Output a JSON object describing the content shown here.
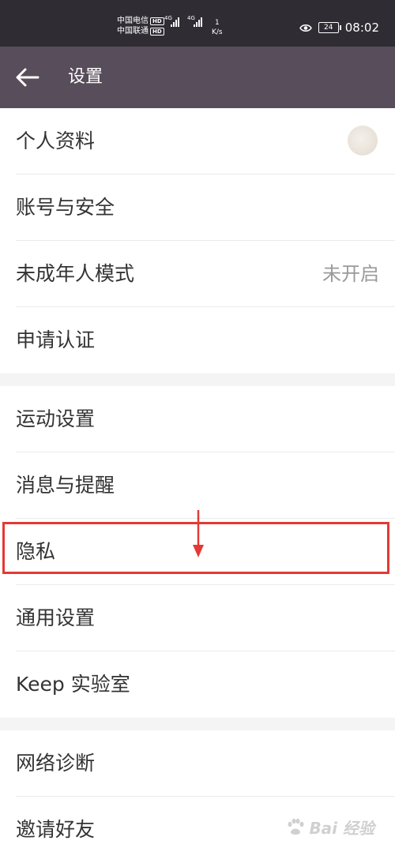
{
  "status_bar": {
    "carrier1": "中国电信",
    "carrier2": "中国联通",
    "hd": "HD",
    "net_tag": "4G",
    "speed_value": "1",
    "speed_unit": "K/s",
    "battery": "24",
    "time": "08:02"
  },
  "header": {
    "title": "设置",
    "back_icon": "back-arrow-icon",
    "background": "#584d5a"
  },
  "groups": [
    {
      "items": [
        {
          "label": "个人资料",
          "value": "",
          "has_avatar": true
        },
        {
          "label": "账号与安全",
          "value": ""
        },
        {
          "label": "未成年人模式",
          "value": "未开启"
        },
        {
          "label": "申请认证",
          "value": ""
        }
      ]
    },
    {
      "items": [
        {
          "label": "运动设置",
          "value": ""
        },
        {
          "label": "消息与提醒",
          "value": ""
        },
        {
          "label": "隐私",
          "value": "",
          "highlighted": true
        },
        {
          "label": "通用设置",
          "value": ""
        },
        {
          "label": "Keep 实验室",
          "value": ""
        }
      ]
    },
    {
      "items": [
        {
          "label": "网络诊断",
          "value": ""
        },
        {
          "label": "邀请好友",
          "value": ""
        }
      ]
    }
  ],
  "annotation": {
    "color": "#e53935",
    "target": "隐私"
  },
  "watermark": {
    "text": "Bai 经验",
    "icon": "paw-icon"
  }
}
